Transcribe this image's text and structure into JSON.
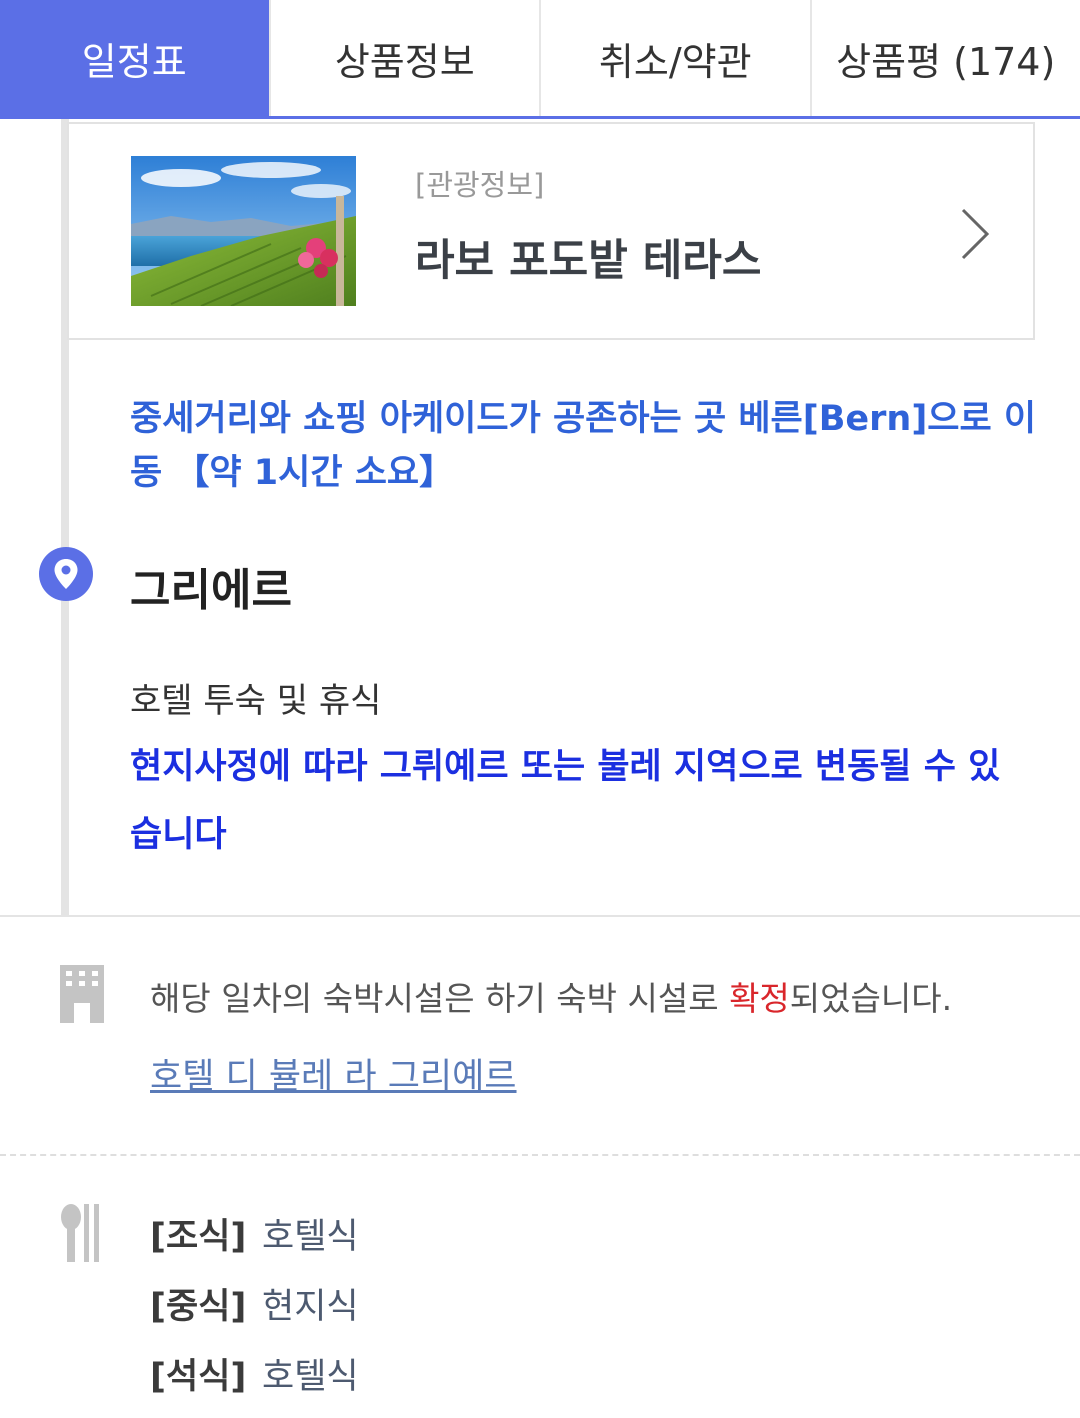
{
  "tabs": [
    {
      "label": "일정표",
      "active": true
    },
    {
      "label": "상품정보",
      "active": false
    },
    {
      "label": "취소/약관",
      "active": false
    },
    {
      "label": "상품평 (174)",
      "active": false
    }
  ],
  "card": {
    "tag": "[관광정보]",
    "title": "라보 포도밭 테라스",
    "chevron_icon": "chevron-right-icon"
  },
  "move_text": "중세거리와 쇼핑 아케이드가 공존하는 곳 베른[Bern]으로 이동 【약 1시간 소요】",
  "location": {
    "icon": "map-pin-icon",
    "title": "그리에르"
  },
  "rest_text": "호텔 투숙 및 휴식",
  "notice_text": "현지사정에 따라 그뤼예르 또는 불레 지역으로 변동될 수 있습니다",
  "hotel": {
    "icon": "building-icon",
    "text_before": "해당 일차의 숙박시설은 하기 숙박 시설로 ",
    "text_confirmed": "확정",
    "text_after": "되었습니다.",
    "link": "호텔 디 뷸레 라 그리예르"
  },
  "meals": {
    "icon": "fork-knife-icon",
    "items": [
      {
        "label": "[조식]",
        "value": "호텔식"
      },
      {
        "label": "[중식]",
        "value": "현지식"
      },
      {
        "label": "[석식]",
        "value": "호텔식"
      }
    ]
  },
  "colors": {
    "accent": "#5b6fe6",
    "move_text": "#2f62d8",
    "notice_text": "#1b2fe0",
    "confirmed": "#d9262b"
  }
}
